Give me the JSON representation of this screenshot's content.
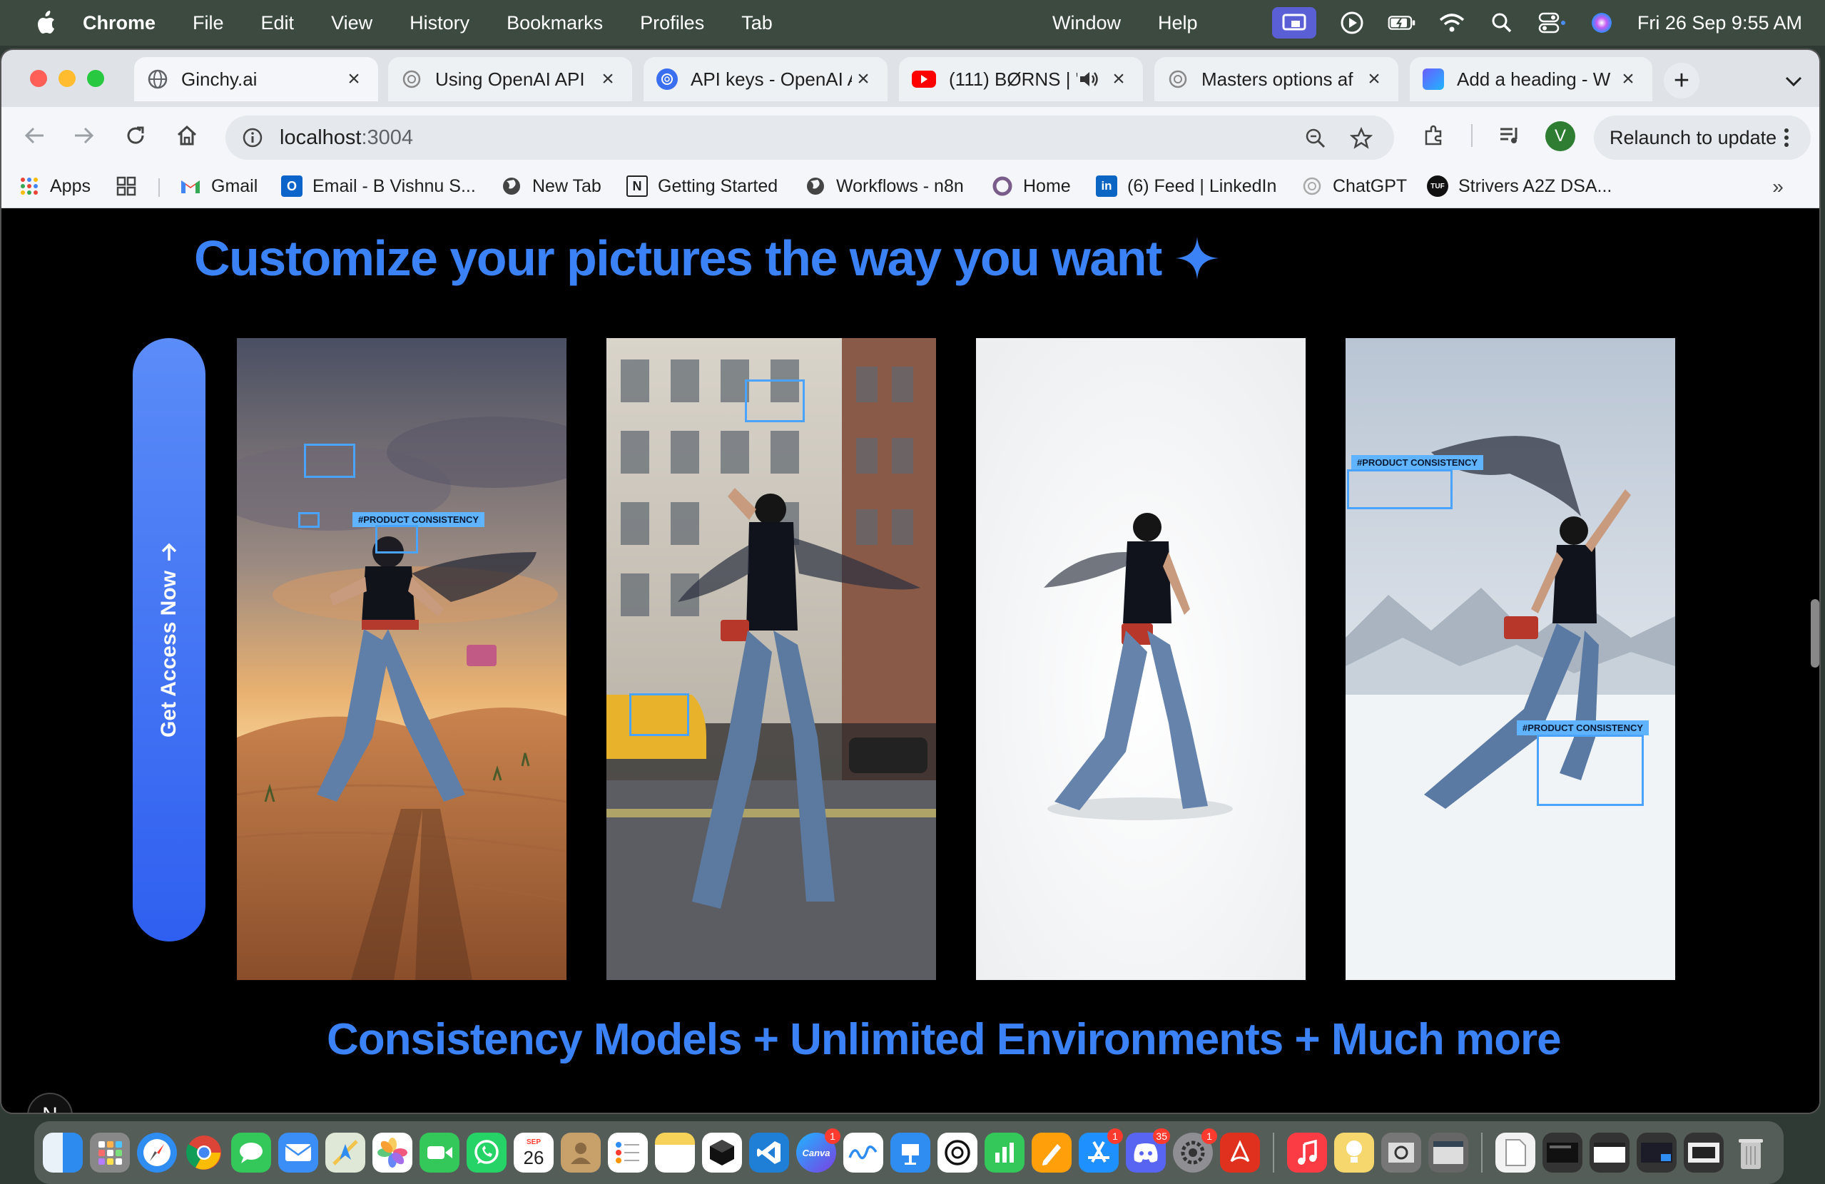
{
  "menubar": {
    "apple_icon": "apple-icon",
    "app_name": "Chrome",
    "items": [
      "File",
      "Edit",
      "View",
      "History",
      "Bookmarks",
      "Profiles",
      "Tab",
      "Window",
      "Help"
    ],
    "clock": "Fri 26 Sep  9:55 AM"
  },
  "tabs": [
    {
      "title": "Ginchy.ai",
      "active": true
    },
    {
      "title": "Using OpenAI API"
    },
    {
      "title": "API keys - OpenAI A"
    },
    {
      "title": "(111) BØRNS | \"",
      "audio": true
    },
    {
      "title": "Masters options af"
    },
    {
      "title": "Add a heading - W"
    }
  ],
  "toolbar": {
    "url_host": "localhost",
    "url_port": ":3004",
    "relaunch_label": "Relaunch to update",
    "avatar_letter": "V"
  },
  "bookmarks": [
    {
      "label": "Apps"
    },
    {
      "label": "Gmail"
    },
    {
      "label": "Email - B Vishnu S..."
    },
    {
      "label": "New Tab"
    },
    {
      "label": "Getting Started"
    },
    {
      "label": "Workflows - n8n"
    },
    {
      "label": "Home"
    },
    {
      "label": "(6) Feed | LinkedIn"
    },
    {
      "label": "ChatGPT"
    },
    {
      "label": "Strivers A2Z DSA..."
    }
  ],
  "page": {
    "headline": "Customize your pictures the way you want",
    "cta_label": "Get Access Now",
    "tag_label": "#PRODUCT CONSISTENCY",
    "footer_line": "Consistency Models + Unlimited Environments + Much more",
    "badge_letter": "N",
    "accent_color": "#3b82f6"
  },
  "dock": {
    "calendar_month": "SEP",
    "calendar_day": "26",
    "badges": {
      "canva": "1",
      "appstore": "1",
      "discord": "35",
      "settings": "1"
    },
    "canva_label": "Canva"
  }
}
